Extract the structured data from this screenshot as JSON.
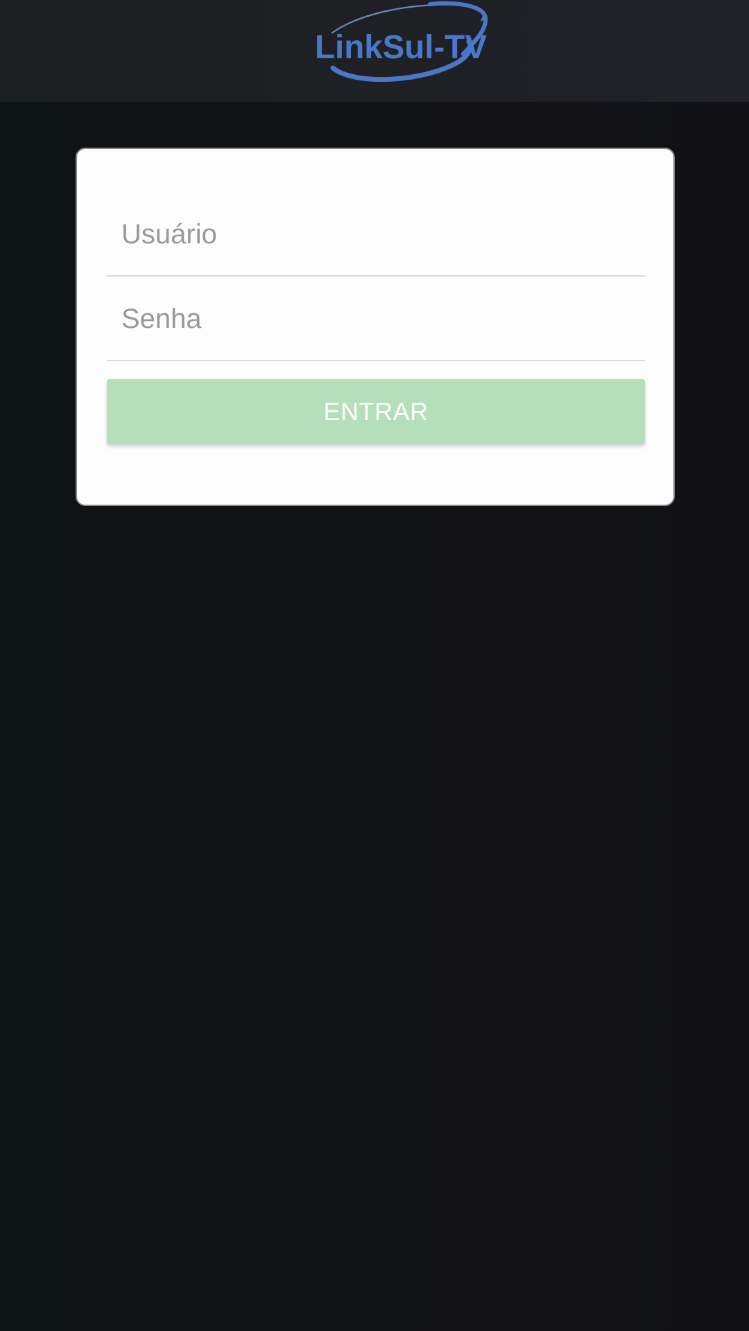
{
  "header": {
    "logo_text": "LinkSul-TV",
    "logo_color": "#4a78c8"
  },
  "login": {
    "username_placeholder": "Usuário",
    "password_placeholder": "Senha",
    "submit_label": "ENTRAR",
    "submit_color": "#b5dfba"
  }
}
